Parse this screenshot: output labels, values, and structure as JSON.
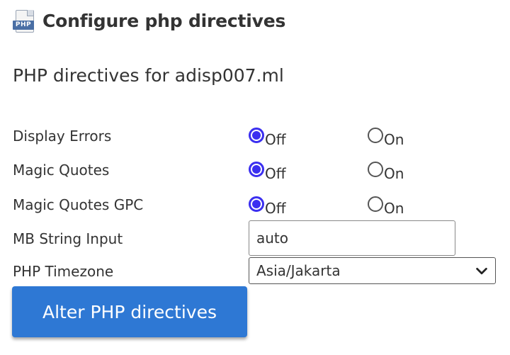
{
  "header": {
    "title": "Configure php directives",
    "icon": "php-file-icon",
    "icon_text": "PHP"
  },
  "subtitle": "PHP directives for adisp007.ml",
  "directives": [
    {
      "label": "Display Errors",
      "selected": "Off",
      "options": [
        "Off",
        "On"
      ]
    },
    {
      "label": "Magic Quotes",
      "selected": "Off",
      "options": [
        "Off",
        "On"
      ]
    },
    {
      "label": "Magic Quotes GPC",
      "selected": "Off",
      "options": [
        "Off",
        "On"
      ]
    }
  ],
  "mb_string": {
    "label": "MB String Input",
    "value": "auto"
  },
  "timezone": {
    "label": "PHP Timezone",
    "value": "Asia/Jakarta"
  },
  "submit_label": "Alter PHP directives",
  "colors": {
    "radio_checked": "#3b2ff0",
    "button": "#2e78d4"
  }
}
